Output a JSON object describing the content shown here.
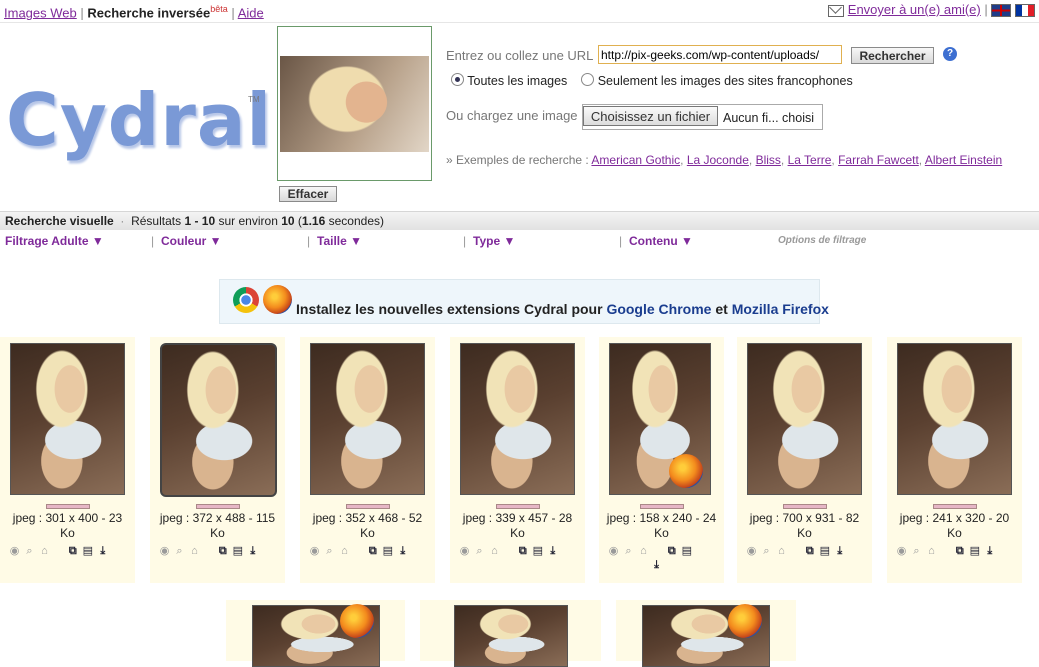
{
  "topbar": {
    "left_links": [
      {
        "label": "Images Web"
      },
      {
        "label": "Recherche inversée",
        "sup": "bêta"
      },
      {
        "label": "Aide"
      }
    ],
    "send_friend": "Envoyer à un(e) ami(e)"
  },
  "logo": {
    "text": "Cydral",
    "tm": "TM"
  },
  "search": {
    "url_label": "Entrez ou collez une URL",
    "url_value": "http://pix-geeks.com/wp-content/uploads/",
    "search_button": "Rechercher",
    "help": "?",
    "radio_all": "Toutes les images",
    "radio_fr": "Seulement les images des sites francophones",
    "upload_label": "Ou chargez une image",
    "file_button": "Choisissez un fichier",
    "file_status": "Aucun fi... choisi",
    "clear_button": "Effacer",
    "examples_label": "» Exemples de recherche :",
    "examples": [
      "American Gothic",
      "La Joconde",
      "Bliss",
      "La Terre",
      "Farrah Fawcett",
      "Albert Einstein"
    ]
  },
  "results": {
    "title": "Recherche visuelle",
    "summary_prefix": "Résultats",
    "range": "1 - 10",
    "summary_mid": "sur environ",
    "total": "10",
    "time": "1.16",
    "time_suffix": "secondes"
  },
  "filters": [
    {
      "label": "Filtrage Adulte ▼"
    },
    {
      "label": "Couleur ▼"
    },
    {
      "label": "Taille ▼"
    },
    {
      "label": "Type ▼"
    },
    {
      "label": "Contenu ▼"
    }
  ],
  "filter_options": "Options de filtrage",
  "extension_banner": {
    "prefix": "Installez les nouvelles extensions Cydral pour",
    "chrome": "Google Chrome",
    "and": "et",
    "firefox": "Mozilla Firefox"
  },
  "results_items": [
    {
      "line1": "jpeg : 301 x 400 - 23",
      "line2": "Ko"
    },
    {
      "line1": "jpeg : 372 x 488 - 115",
      "line2": "Ko"
    },
    {
      "line1": "jpeg : 352 x 468 - 52",
      "line2": "Ko"
    },
    {
      "line1": "jpeg : 339 x 457 - 28",
      "line2": "Ko"
    },
    {
      "line1": "jpeg : 158 x 240 - 24",
      "line2": "Ko"
    },
    {
      "line1": "jpeg : 700 x 931 - 82",
      "line2": "Ko"
    },
    {
      "line1": "jpeg : 241 x 320 - 20",
      "line2": "Ko"
    }
  ],
  "icons": [
    "eye-icon",
    "zoom-icon",
    "similar-search-icon",
    "copy-icon",
    "page-icon",
    "download-icon"
  ]
}
